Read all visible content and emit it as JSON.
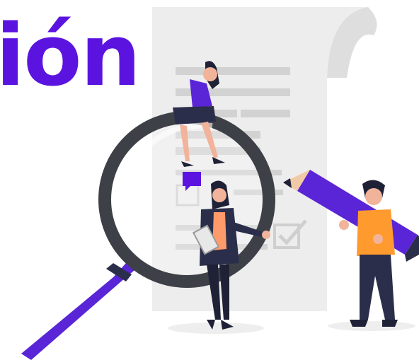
{
  "heading": {
    "text": "ión"
  },
  "colors": {
    "accent": "#5b14e0",
    "paper": "#ededed",
    "paper_fold": "#dedede",
    "lines": "#d2d2d2",
    "lens_ring": "#3d4147",
    "handle": "#5a25d6",
    "pencil": "#5a25d6",
    "skin": "#f2b39b",
    "hair": "#1f2236",
    "jacket_dark": "#2b2e4a",
    "shirt_orange": "#ff9a2e",
    "pants": "#2b2e4a"
  },
  "icons": [
    "magnifier-icon",
    "document-icon",
    "checkbox-icon",
    "pencil-icon",
    "speech-bubble-icon"
  ]
}
